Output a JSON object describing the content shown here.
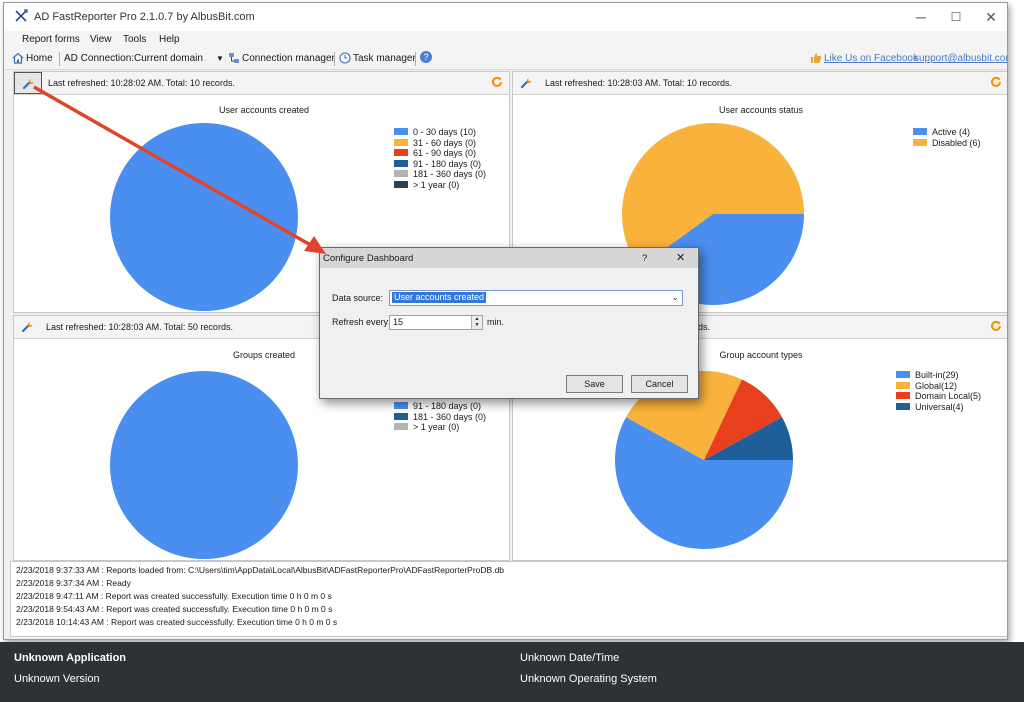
{
  "window": {
    "title": "AD FastReporter Pro 2.1.0.7 by AlbusBit.com",
    "minimize": "─",
    "maximize": "☐",
    "close": "✕"
  },
  "menu": [
    "Report forms",
    "View",
    "Tools",
    "Help"
  ],
  "toolbar": {
    "home": "Home",
    "ad_connection_label": "AD Connection:",
    "ad_connection_value": "Current domain",
    "connection_manager": "Connection manager",
    "task_manager": "Task manager",
    "help": "?",
    "facebook": "Like Us on Facebook",
    "support": "support@albusbit.com"
  },
  "panels": [
    {
      "refresh_text": "Last refreshed: 10:28:02 AM. Total: 10 records.",
      "chart_title": "User accounts created",
      "legend": [
        "0 - 30 days (10)",
        "31 - 60 days (0)",
        "61 - 90 days (0)",
        "91 - 180 days (0)",
        "181 - 360 days (0)",
        "> 1 year (0)"
      ]
    },
    {
      "refresh_text": "Last refreshed: 10:28:03 AM. Total: 10 records.",
      "chart_title": "User accounts status",
      "legend": [
        "Active (4)",
        "Disabled (6)"
      ]
    },
    {
      "refresh_text": "Last refreshed: 10:28:03 AM. Total: 50 records.",
      "chart_title": "Groups created",
      "legend": [
        "91 - 180 days (0)",
        "181 - 360 days (0)",
        "> 1 year (0)"
      ]
    },
    {
      "refresh_text": "rds.",
      "chart_title": "Group account types",
      "legend": [
        "Built-in(29)",
        "Global(12)",
        "Domain Local(5)",
        "Universal(4)"
      ]
    }
  ],
  "colors": {
    "blue": "#4a8ef0",
    "orange": "#f9b23c",
    "red": "#e8401f",
    "dark_blue": "#1f5f99",
    "gray": "#b3b3b3",
    "navy": "#29415a",
    "arrow": "#e0452a",
    "refresh_icon": "#f29100"
  },
  "chart_data": [
    {
      "type": "pie",
      "title": "User accounts created",
      "categories": [
        "0 - 30 days",
        "31 - 60 days",
        "61 - 90 days",
        "91 - 180 days",
        "181 - 360 days",
        "> 1 year"
      ],
      "values": [
        10,
        0,
        0,
        0,
        0,
        0
      ],
      "colors": [
        "#4a8ef0",
        "#f9b23c",
        "#e8401f",
        "#1f5f99",
        "#b3b3b3",
        "#29415a"
      ]
    },
    {
      "type": "pie",
      "title": "User accounts status",
      "categories": [
        "Active",
        "Disabled"
      ],
      "values": [
        4,
        6
      ],
      "colors": [
        "#4a8ef0",
        "#f9b23c"
      ]
    },
    {
      "type": "pie",
      "title": "Groups created",
      "categories": [
        "91 - 180 days",
        "181 - 360 days",
        "> 1 year"
      ],
      "values": [
        50,
        0,
        0
      ],
      "colors": [
        "#4a8ef0",
        "#1f5f99",
        "#b3b3b3"
      ]
    },
    {
      "type": "pie",
      "title": "Group account types",
      "categories": [
        "Built-in",
        "Global",
        "Domain Local",
        "Universal"
      ],
      "values": [
        29,
        12,
        5,
        4
      ],
      "colors": [
        "#4a8ef0",
        "#f9b23c",
        "#e8401f",
        "#1f5f99"
      ]
    }
  ],
  "dialog": {
    "title": "Configure Dashboard",
    "help": "?",
    "close": "✕",
    "data_source_label": "Data source:",
    "data_source_value": "User accounts created",
    "refresh_label": "Refresh every:",
    "refresh_value": "15",
    "refresh_unit": "min.",
    "save": "Save",
    "cancel": "Cancel"
  },
  "log": [
    "2/23/2018 9:37:33 AM : Reports loaded from: C:\\Users\\tim\\AppData\\Local\\AlbusBit\\ADFastReporterPro\\ADFastReporterProDB.db",
    "2/23/2018 9:37:34 AM : Ready",
    "2/23/2018 9:47:11 AM : Report was created successfully. Execution time 0 h 0 m 0 s",
    "2/23/2018 9:54:43 AM : Report was created successfully. Execution time 0 h 0 m 0 s",
    "2/23/2018 10:14:43 AM : Report was created successfully. Execution time 0 h 0 m 0 s"
  ],
  "status_bar": {
    "application": "Unknown Application",
    "version": "Unknown Version",
    "datetime": "Unknown Date/Time",
    "os": "Unknown Operating System"
  }
}
